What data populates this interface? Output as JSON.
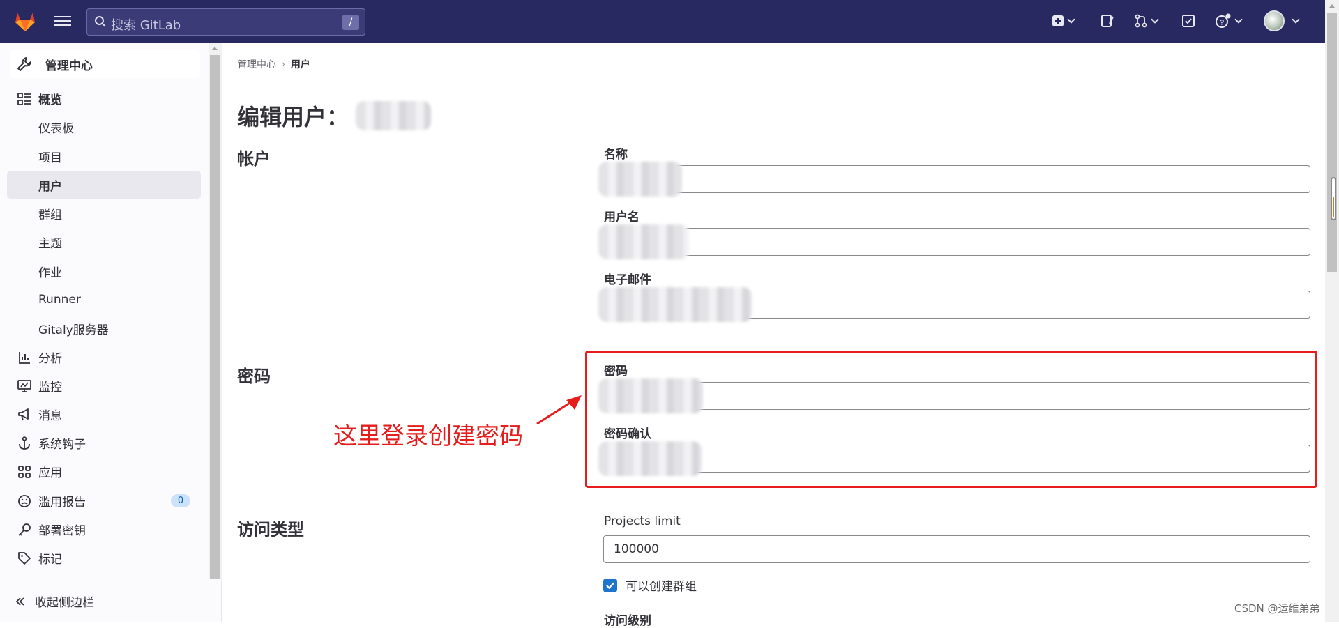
{
  "topbar": {
    "search_placeholder": "搜索 GitLab",
    "search_shortcut": "/"
  },
  "sidebar": {
    "admin_title": "管理中心",
    "items": [
      {
        "label": "概览",
        "icon": "overview-icon"
      },
      {
        "label": "仪表板"
      },
      {
        "label": "项目"
      },
      {
        "label": "用户"
      },
      {
        "label": "群组"
      },
      {
        "label": "主题"
      },
      {
        "label": "作业"
      },
      {
        "label": "Runner"
      },
      {
        "label": "Gitaly服务器"
      },
      {
        "label": "分析",
        "icon": "chart-icon"
      },
      {
        "label": "监控",
        "icon": "monitor-icon"
      },
      {
        "label": "消息",
        "icon": "megaphone-icon"
      },
      {
        "label": "系统钩子",
        "icon": "anchor-icon"
      },
      {
        "label": "应用",
        "icon": "apps-icon"
      },
      {
        "label": "滥用报告",
        "icon": "abuse-icon",
        "badge": "0"
      },
      {
        "label": "部署密钥",
        "icon": "key-icon"
      },
      {
        "label": "标记",
        "icon": "tag-icon"
      }
    ],
    "collapse_label": "收起侧边栏"
  },
  "breadcrumb": {
    "root": "管理中心",
    "current": "用户"
  },
  "page": {
    "title": "编辑用户：",
    "sections": {
      "account": "帐户",
      "password": "密码",
      "access": "访问类型"
    },
    "fields": {
      "name_label": "名称",
      "username_label": "用户名",
      "email_label": "电子邮件",
      "password_label": "密码",
      "password_confirm_label": "密码确认",
      "projects_limit_label": "Projects limit",
      "projects_limit_value": "100000",
      "can_create_group_label": "可以创建群组",
      "can_create_group_checked": true,
      "access_level_label": "访问级别"
    },
    "annotation": "这里登录创建密码",
    "watermark": "CSDN @运维弟弟"
  },
  "colors": {
    "topbar": "#292961",
    "highlight": "#e51d1d",
    "checkbox": "#1f75cb"
  }
}
